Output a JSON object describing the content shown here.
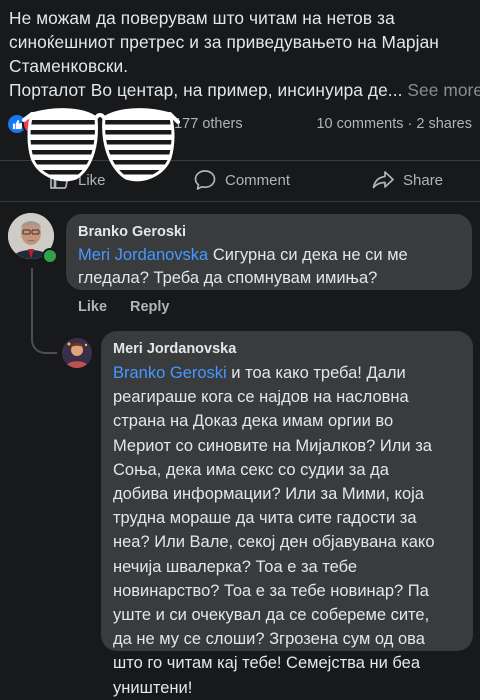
{
  "post": {
    "text_lines": [
      "Не можам да поверувам што читам на нетов за",
      "синоќешниот претрес и за приведувањето на Марјан",
      "Стаменковски.",
      "Порталот Во центар, на пример, инсинуира де..."
    ],
    "see_more": "See more"
  },
  "stats": {
    "reactions_others": "d 177 others",
    "counts": "10 comments · 2 shares"
  },
  "actions": {
    "like": "Like",
    "comment": "Comment",
    "share": "Share"
  },
  "comment1": {
    "author": "Branko Geroski",
    "mention": "Meri Jordanovska",
    "line1_rest": " Сигурна си дека не си ме",
    "line2": "гледала? Треба да спомнувам имиња?",
    "like": "Like",
    "reply": "Reply"
  },
  "comment2": {
    "author": "Meri Jordanovska",
    "mention": "Branko Geroski",
    "line1_rest": " и тоа како треба! Дали",
    "lines": [
      "реагираше кога се најдов на насловна",
      "страна на Доказ дека имам оргии во",
      "Мериот со синовите на Мијалков? Или за",
      "Соња, дека има секс со судии за да",
      "добива информации? Или за Мими, која",
      "трудна мораше да чита сите гадости за",
      "неа? Или Вале, секој ден објавувана како",
      "нечија швалерка? Тоа е за тебе",
      "новинарство? Тоа е за тебе новинар? Па",
      "уште и си очекувал да се собереме сите,",
      "да не му се слоши? Згрозена сум од ова",
      "што го читам кај тебе! Семејства ни беа",
      "уништени!"
    ]
  },
  "colors": {
    "background": "#18191a",
    "bubble": "#3a3b3c",
    "mention": "#4599ff",
    "online": "#31a24c"
  }
}
